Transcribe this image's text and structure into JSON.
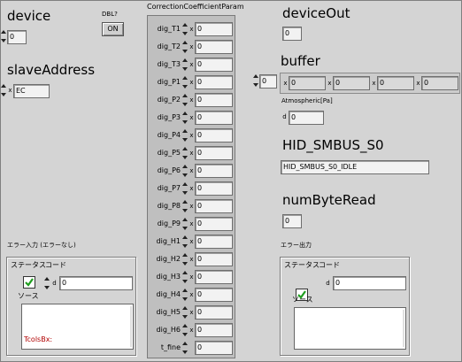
{
  "device": {
    "label": "device",
    "value": "0"
  },
  "dbl": {
    "label": "DBL?",
    "button": "ON"
  },
  "slaveAddress": {
    "label": "slaveAddress",
    "radix": "x",
    "value": "EC"
  },
  "ccp": {
    "title": "CorrectionCoefficientParam",
    "rows": [
      {
        "label": "dig_T1",
        "radix": "x",
        "value": "0"
      },
      {
        "label": "dig_T2",
        "radix": "x",
        "value": "0"
      },
      {
        "label": "dig_T3",
        "radix": "x",
        "value": "0"
      },
      {
        "label": "dig_P1",
        "radix": "x",
        "value": "0"
      },
      {
        "label": "dig_P2",
        "radix": "x",
        "value": "0"
      },
      {
        "label": "dig_P3",
        "radix": "x",
        "value": "0"
      },
      {
        "label": "dig_P4",
        "radix": "x",
        "value": "0"
      },
      {
        "label": "dig_P5",
        "radix": "x",
        "value": "0"
      },
      {
        "label": "dig_P6",
        "radix": "x",
        "value": "0"
      },
      {
        "label": "dig_P7",
        "radix": "x",
        "value": "0"
      },
      {
        "label": "dig_P8",
        "radix": "x",
        "value": "0"
      },
      {
        "label": "dig_P9",
        "radix": "x",
        "value": "0"
      },
      {
        "label": "dig_H1",
        "radix": "x",
        "value": "0"
      },
      {
        "label": "dig_H2",
        "radix": "x",
        "value": "0"
      },
      {
        "label": "dig_H3",
        "radix": "x",
        "value": "0"
      },
      {
        "label": "dig_H4",
        "radix": "x",
        "value": "0"
      },
      {
        "label": "dig_H5",
        "radix": "x",
        "value": "0"
      },
      {
        "label": "dig_H6",
        "radix": "x",
        "value": "0"
      },
      {
        "label": "t_fine",
        "radix": "",
        "value": "0"
      }
    ]
  },
  "deviceOut": {
    "label": "deviceOut",
    "value": "0"
  },
  "buffer": {
    "label": "buffer",
    "index": "0",
    "items": [
      {
        "radix": "x",
        "value": "0"
      },
      {
        "radix": "x",
        "value": "0"
      },
      {
        "radix": "x",
        "value": "0"
      },
      {
        "radix": "x",
        "value": "0"
      }
    ]
  },
  "atmospheric": {
    "label": "Atmospheric[Pa]",
    "radix": "d",
    "value": "0"
  },
  "hidSmbus": {
    "label": "HID_SMBUS_S0",
    "value": "HID_SMBUS_S0_IDLE"
  },
  "numByteRead": {
    "label": "numByteRead",
    "value": "0"
  },
  "errorIn": {
    "title": "エラー入力 (エラーなし)",
    "statusLabel": "ステータス",
    "codeLabel": "コード",
    "radix": "d",
    "codeValue": "0",
    "sourceLabel": "ソース",
    "sourceText": "TcolsBx:"
  },
  "errorOut": {
    "title": "エラー出力",
    "statusLabel": "ステータス",
    "codeLabel": "コード",
    "radix": "d",
    "codeValue": "0",
    "sourceLabel": "ソース",
    "sourceText": ""
  },
  "colors": {
    "background": "#d4d4d4",
    "checkGreen": "#1f9e1f",
    "sourceText": "#b00000"
  }
}
